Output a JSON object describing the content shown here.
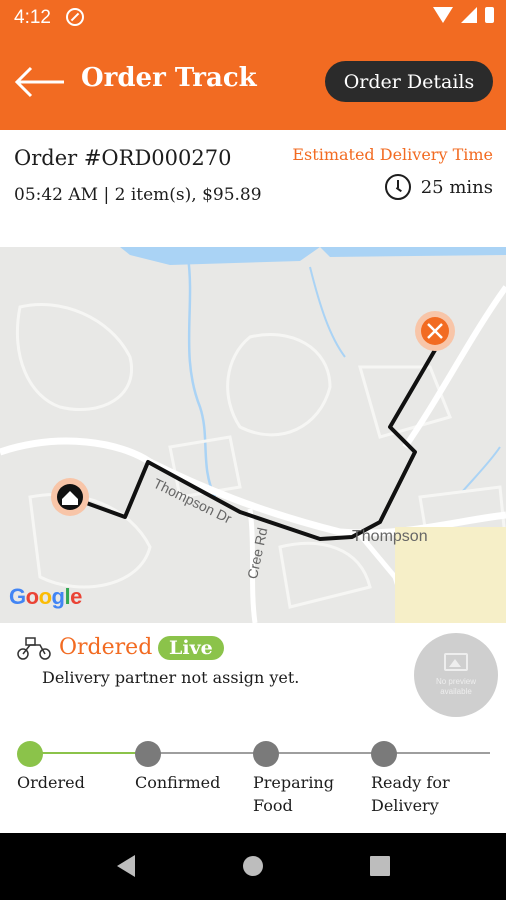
{
  "status_bar": {
    "time": "4:12",
    "icons": [
      "do-not-disturb-icon",
      "wifi-icon",
      "signal-icon",
      "battery-icon"
    ]
  },
  "app_bar": {
    "title": "Order Track",
    "order_details_label": "Order Details",
    "background_color": "#f26b22"
  },
  "order": {
    "id": "Order #ORD000270",
    "meta": "05:42 AM | 2 item(s), $95.89",
    "eta_label": "Estimated Delivery Time",
    "eta_value": "25 mins"
  },
  "map": {
    "street_labels": [
      "Thompson Dr",
      "Thompson",
      "Cree Rd"
    ],
    "attribution": "Google",
    "markers": [
      "home-marker-icon",
      "restaurant-marker-icon"
    ]
  },
  "status": {
    "title": "Ordered",
    "badge": "Live",
    "description": "Delivery partner not assign yet.",
    "image_placeholder": "No preview available"
  },
  "steps": [
    {
      "label": "Ordered",
      "active": true
    },
    {
      "label": "Confirmed",
      "active": false
    },
    {
      "label": "Preparing Food",
      "active": false
    },
    {
      "label": "Ready for Delivery",
      "active": false
    }
  ],
  "colors": {
    "accent": "#f26b22",
    "live": "#8bc34a",
    "step_active": "#8bc34a",
    "step_inactive": "#7a7a7a"
  }
}
